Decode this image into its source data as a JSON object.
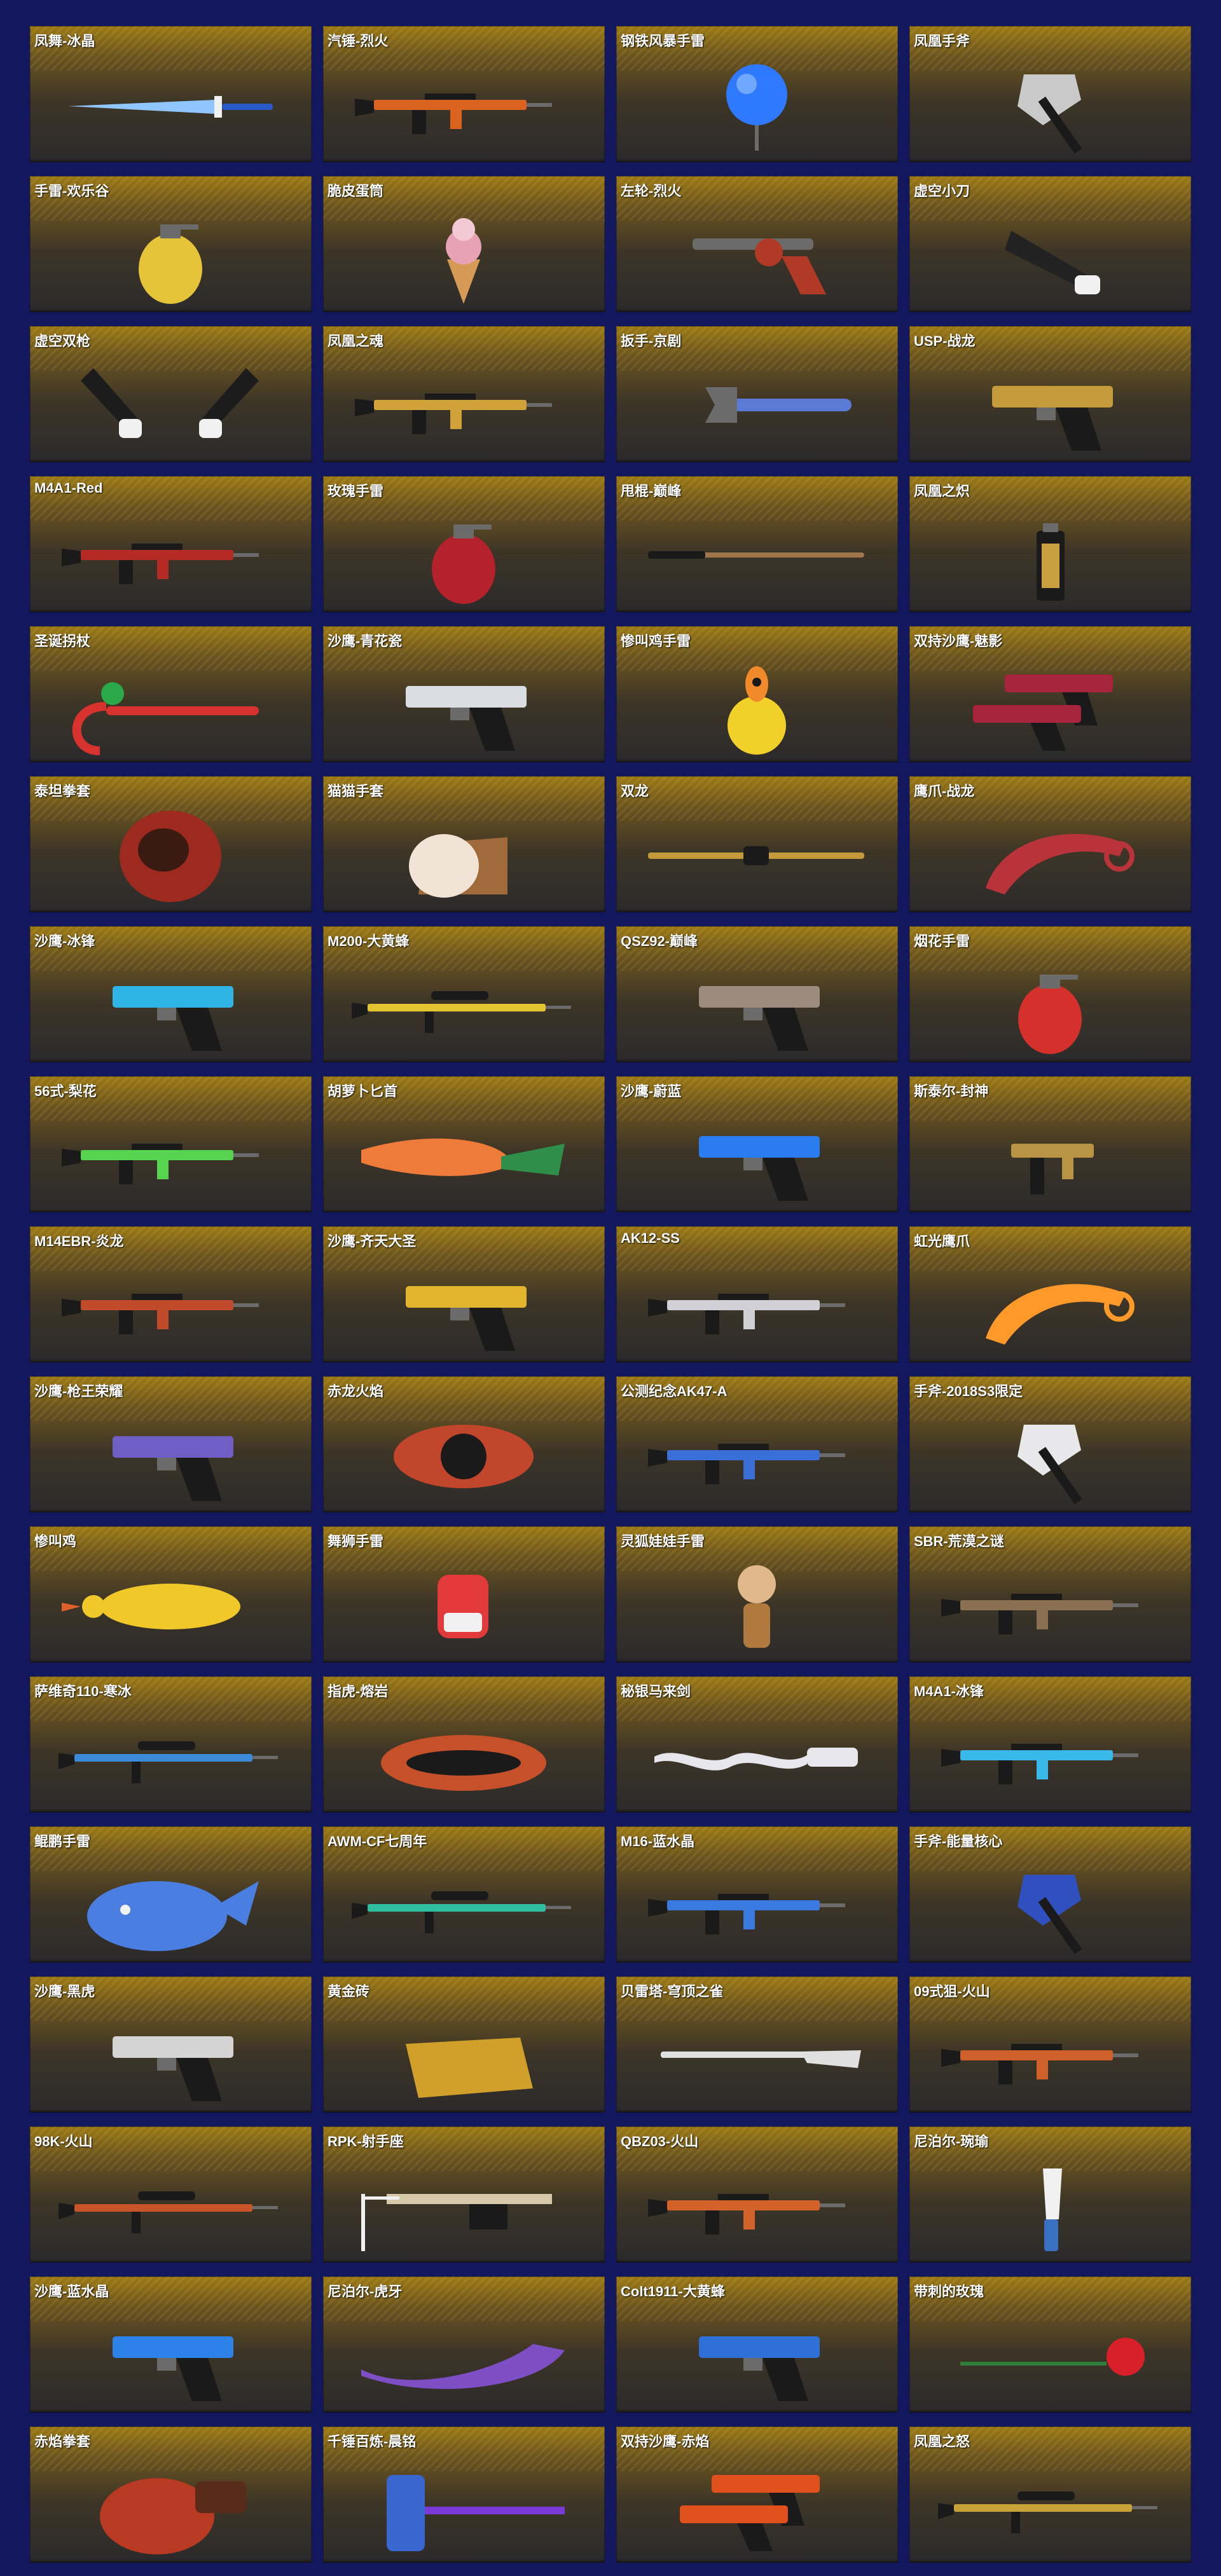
{
  "items": [
    {
      "name": "凤舞-冰晶",
      "icon": "sword-icon",
      "color": "#8fc6ff"
    },
    {
      "name": "汽锤-烈火",
      "icon": "rifle-icon",
      "color": "#d9631f"
    },
    {
      "name": "钢铁风暴手雷",
      "icon": "grenade-orb-icon",
      "color": "#2f79ff"
    },
    {
      "name": "凤凰手斧",
      "icon": "axe-icon",
      "color": "#c9c9c9"
    },
    {
      "name": "手雷-欢乐谷",
      "icon": "grenade-icon",
      "color": "#e6c43a"
    },
    {
      "name": "脆皮蛋筒",
      "icon": "icecream-icon",
      "color": "#e7a2b6"
    },
    {
      "name": "左轮-烈火",
      "icon": "revolver-icon",
      "color": "#b03a26"
    },
    {
      "name": "虚空小刀",
      "icon": "glove-icon",
      "color": "#222222"
    },
    {
      "name": "虚空双枪",
      "icon": "glove-pair-icon",
      "color": "#1c1c1c"
    },
    {
      "name": "凤凰之魂",
      "icon": "rifle-icon",
      "color": "#d2a23a"
    },
    {
      "name": "扳手-京剧",
      "icon": "wrench-icon",
      "color": "#5a7ad6"
    },
    {
      "name": "USP-战龙",
      "icon": "pistol-icon",
      "color": "#c59a3b"
    },
    {
      "name": "M4A1-Red",
      "icon": "rifle-icon",
      "color": "#b52a24"
    },
    {
      "name": "玫瑰手雷",
      "icon": "grenade-icon",
      "color": "#b5222c"
    },
    {
      "name": "甩棍-巅峰",
      "icon": "baton-icon",
      "color": "#a0764d"
    },
    {
      "name": "凤凰之炽",
      "icon": "canister-icon",
      "color": "#c8a040"
    },
    {
      "name": "圣诞拐杖",
      "icon": "candy-cane-icon",
      "color": "#d8322e"
    },
    {
      "name": "沙鹰-青花瓷",
      "icon": "pistol-icon",
      "color": "#dadde3"
    },
    {
      "name": "惨叫鸡手雷",
      "icon": "chicken-grenade-icon",
      "color": "#f2d02a"
    },
    {
      "name": "双持沙鹰-魅影",
      "icon": "pistol-pair-icon",
      "color": "#a8233c"
    },
    {
      "name": "泰坦拳套",
      "icon": "fist-icon",
      "color": "#9c2a1e"
    },
    {
      "name": "猫猫手套",
      "icon": "paw-icon",
      "color": "#f1e3d6"
    },
    {
      "name": "双龙",
      "icon": "dual-blade-icon",
      "color": "#c59a3b"
    },
    {
      "name": "鹰爪-战龙",
      "icon": "karambit-icon",
      "color": "#b8333a"
    },
    {
      "name": "沙鹰-冰锋",
      "icon": "pistol-icon",
      "color": "#2fb4e6"
    },
    {
      "name": "M200-大黄蜂",
      "icon": "sniper-icon",
      "color": "#e2c531"
    },
    {
      "name": "QSZ92-巅峰",
      "icon": "pistol-icon",
      "color": "#9c8c80"
    },
    {
      "name": "烟花手雷",
      "icon": "grenade-icon",
      "color": "#d5302c"
    },
    {
      "name": "56式-梨花",
      "icon": "rifle-icon",
      "color": "#57d44f"
    },
    {
      "name": "胡萝卜匕首",
      "icon": "carrot-icon",
      "color": "#ee7b3a"
    },
    {
      "name": "沙鹰-蔚蓝",
      "icon": "pistol-icon",
      "color": "#2a7df0"
    },
    {
      "name": "斯泰尔-封神",
      "icon": "smg-icon",
      "color": "#b89444"
    },
    {
      "name": "M14EBR-炎龙",
      "icon": "rifle-icon",
      "color": "#c04a2a"
    },
    {
      "name": "沙鹰-齐天大圣",
      "icon": "pistol-icon",
      "color": "#e3b52f"
    },
    {
      "name": "AK12-SS",
      "icon": "rifle-icon",
      "color": "#d0d0d6"
    },
    {
      "name": "虹光鹰爪",
      "icon": "karambit-icon",
      "color": "#ff9a2a"
    },
    {
      "name": "沙鹰-枪王荣耀",
      "icon": "pistol-icon",
      "color": "#6f5fc4"
    },
    {
      "name": "赤龙火焰",
      "icon": "dragon-gun-icon",
      "color": "#c2462c"
    },
    {
      "name": "公测纪念AK47-A",
      "icon": "rifle-icon",
      "color": "#3a6fd8"
    },
    {
      "name": "手斧-2018S3限定",
      "icon": "axe-icon",
      "color": "#e8e8ea"
    },
    {
      "name": "惨叫鸡",
      "icon": "chicken-icon",
      "color": "#f0c82a"
    },
    {
      "name": "舞狮手雷",
      "icon": "lion-icon",
      "color": "#e23a3a"
    },
    {
      "name": "灵狐娃娃手雷",
      "icon": "doll-icon",
      "color": "#e0b88a"
    },
    {
      "name": "SBR-荒漠之谜",
      "icon": "rifle-icon",
      "color": "#8a7050"
    },
    {
      "name": "萨维奇110-寒冰",
      "icon": "sniper-icon",
      "color": "#3b8bd8"
    },
    {
      "name": "指虎-熔岩",
      "icon": "knuckle-icon",
      "color": "#c5502a"
    },
    {
      "name": "秘银马来剑",
      "icon": "kris-icon",
      "color": "#e6e6ec"
    },
    {
      "name": "M4A1-冰锋",
      "icon": "rifle-icon",
      "color": "#39b8ea"
    },
    {
      "name": "鲲鹏手雷",
      "icon": "whale-icon",
      "color": "#4a7ee0"
    },
    {
      "name": "AWM-CF七周年",
      "icon": "sniper-icon",
      "color": "#2fbfa0"
    },
    {
      "name": "M16-蓝水晶",
      "icon": "rifle-icon",
      "color": "#3a7ae0"
    },
    {
      "name": "手斧-能量核心",
      "icon": "axe-icon",
      "color": "#3050c0"
    },
    {
      "name": "沙鹰-黑虎",
      "icon": "pistol-icon",
      "color": "#d4d4d4"
    },
    {
      "name": "黄金砖",
      "icon": "gold-bar-icon",
      "color": "#d0a02a"
    },
    {
      "name": "贝雷塔-穹顶之雀",
      "icon": "shotgun-icon",
      "color": "#e0e0e0"
    },
    {
      "name": "09式狙-火山",
      "icon": "rifle-icon",
      "color": "#d0602a"
    },
    {
      "name": "98K-火山",
      "icon": "sniper-icon",
      "color": "#c8542a"
    },
    {
      "name": "RPK-射手座",
      "icon": "lmg-icon",
      "color": "#d6c8a8"
    },
    {
      "name": "QBZ03-火山",
      "icon": "rifle-icon",
      "color": "#d2622a"
    },
    {
      "name": "尼泊尔-琬瑜",
      "icon": "knife-icon",
      "color": "#3a70c0"
    },
    {
      "name": "沙鹰-蓝水晶",
      "icon": "pistol-icon",
      "color": "#2c82e8"
    },
    {
      "name": "尼泊尔-虎牙",
      "icon": "kukri-icon",
      "color": "#7d4ec4"
    },
    {
      "name": "Colt1911-大黄蜂",
      "icon": "pistol-icon",
      "color": "#2e6fd8"
    },
    {
      "name": "带刺的玫瑰",
      "icon": "rose-icon",
      "color": "#d8202a"
    },
    {
      "name": "赤焰拳套",
      "icon": "boxing-glove-icon",
      "color": "#b83a22"
    },
    {
      "name": "千锤百炼-晨铭",
      "icon": "can-hammer-icon",
      "color": "#3a66d0"
    },
    {
      "name": "双持沙鹰-赤焰",
      "icon": "pistol-pair-icon",
      "color": "#e2501e"
    },
    {
      "name": "凤凰之怒",
      "icon": "sniper-icon",
      "color": "#c9a23a"
    }
  ]
}
